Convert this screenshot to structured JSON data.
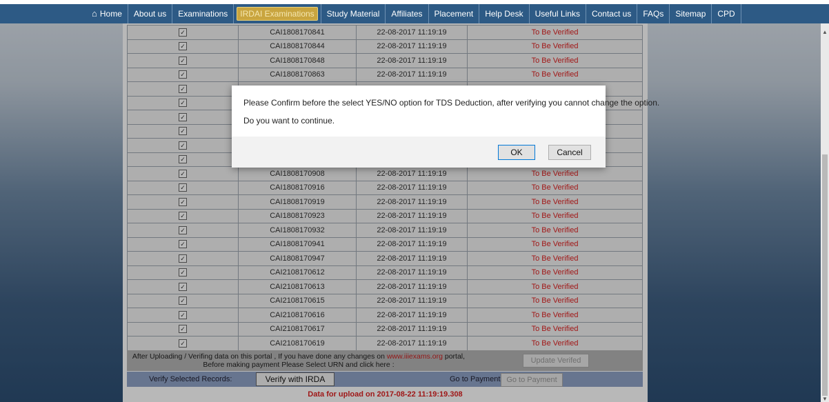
{
  "nav": {
    "items": [
      "Home",
      "About us",
      "Examinations",
      "IRDAI Examinations",
      "Study Material",
      "Affiliates",
      "Placement",
      "Help Desk",
      "Useful Links",
      "Contact us",
      "FAQs",
      "Sitemap",
      "CPD"
    ],
    "active_index": 3
  },
  "records": [
    {
      "urn": "CAI1808170841",
      "date": "22-08-2017 11:19:19",
      "status": "To Be Verified"
    },
    {
      "urn": "CAI1808170844",
      "date": "22-08-2017 11:19:19",
      "status": "To Be Verified"
    },
    {
      "urn": "CAI1808170848",
      "date": "22-08-2017 11:19:19",
      "status": "To Be Verified"
    },
    {
      "urn": "CAI1808170863",
      "date": "22-08-2017 11:19:19",
      "status": "To Be Verified"
    },
    {
      "urn": "",
      "date": "",
      "status": ""
    },
    {
      "urn": "",
      "date": "",
      "status": ""
    },
    {
      "urn": "",
      "date": "",
      "status": ""
    },
    {
      "urn": "",
      "date": "",
      "status": ""
    },
    {
      "urn": "",
      "date": "",
      "status": ""
    },
    {
      "urn": "",
      "date": "",
      "status": ""
    },
    {
      "urn": "CAI1808170908",
      "date": "22-08-2017 11:19:19",
      "status": "To Be Verified"
    },
    {
      "urn": "CAI1808170916",
      "date": "22-08-2017 11:19:19",
      "status": "To Be Verified"
    },
    {
      "urn": "CAI1808170919",
      "date": "22-08-2017 11:19:19",
      "status": "To Be Verified"
    },
    {
      "urn": "CAI1808170923",
      "date": "22-08-2017 11:19:19",
      "status": "To Be Verified"
    },
    {
      "urn": "CAI1808170932",
      "date": "22-08-2017 11:19:19",
      "status": "To Be Verified"
    },
    {
      "urn": "CAI1808170941",
      "date": "22-08-2017 11:19:19",
      "status": "To Be Verified"
    },
    {
      "urn": "CAI1808170947",
      "date": "22-08-2017 11:19:19",
      "status": "To Be Verified"
    },
    {
      "urn": "CAI2108170612",
      "date": "22-08-2017 11:19:19",
      "status": "To Be Verified"
    },
    {
      "urn": "CAI2108170613",
      "date": "22-08-2017 11:19:19",
      "status": "To Be Verified"
    },
    {
      "urn": "CAI2108170615",
      "date": "22-08-2017 11:19:19",
      "status": "To Be Verified"
    },
    {
      "urn": "CAI2108170616",
      "date": "22-08-2017 11:19:19",
      "status": "To Be Verified"
    },
    {
      "urn": "CAI2108170617",
      "date": "22-08-2017 11:19:19",
      "status": "To Be Verified"
    },
    {
      "urn": "CAI2108170619",
      "date": "22-08-2017 11:19:19",
      "status": "To Be Verified"
    }
  ],
  "footer": {
    "note_part1": "After Uploading / Verifing data on this portal , If you have done any changes on ",
    "note_link": "www.iiiexams.org",
    "note_part2": " portal,",
    "note_line2": "Before making payment Please Select URN and click here :",
    "update_button": "Update Verifed",
    "verify_label": "Verify Selected Records:",
    "verify_button": "Verify with IRDA",
    "payment_label": "Go to Payment:",
    "payment_button": "Go to Payment",
    "upload_info": "Data for upload on 2017-08-22 11:19:19.308"
  },
  "dialog": {
    "message": "Please Confirm before the select YES/NO option for TDS Deduction, after verifying you cannot change the option.",
    "question": "Do you want to continue.",
    "ok": "OK",
    "cancel": "Cancel"
  },
  "colors": {
    "status": "#e02020",
    "nav": "#2d5a85",
    "active_tab": "#c9a53f"
  }
}
